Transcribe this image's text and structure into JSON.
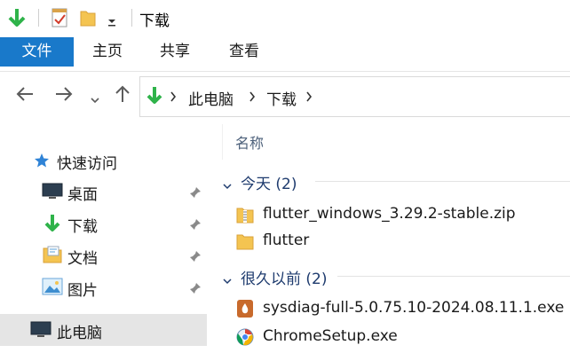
{
  "window": {
    "title": "下载"
  },
  "ribbon": {
    "tabs": [
      "文件",
      "主页",
      "共享",
      "查看"
    ]
  },
  "address": {
    "crumbs": [
      "此电脑",
      "下载"
    ]
  },
  "sidebar": {
    "quick_access": "快速访问",
    "items": [
      {
        "label": "桌面",
        "icon": "desktop-icon",
        "pinned": true
      },
      {
        "label": "下载",
        "icon": "download-arrow-icon",
        "pinned": true
      },
      {
        "label": "文档",
        "icon": "documents-icon",
        "pinned": true
      },
      {
        "label": "图片",
        "icon": "pictures-icon",
        "pinned": true
      }
    ],
    "this_pc": "此电脑"
  },
  "content": {
    "column_header": "名称",
    "groups": [
      {
        "label": "今天 (2)",
        "files": [
          {
            "name": "flutter_windows_3.29.2-stable.zip",
            "icon": "zip-folder-icon"
          },
          {
            "name": "flutter",
            "icon": "folder-icon"
          }
        ]
      },
      {
        "label": "很久以前 (2)",
        "files": [
          {
            "name": "sysdiag-full-5.0.75.10-2024.08.11.1.exe",
            "icon": "installer-exe-icon"
          },
          {
            "name": "ChromeSetup.exe",
            "icon": "chrome-setup-icon"
          }
        ]
      }
    ]
  },
  "colors": {
    "accent": "#1979ca",
    "download_green": "#2fb34a",
    "selected_bg": "#e5e5e5"
  }
}
